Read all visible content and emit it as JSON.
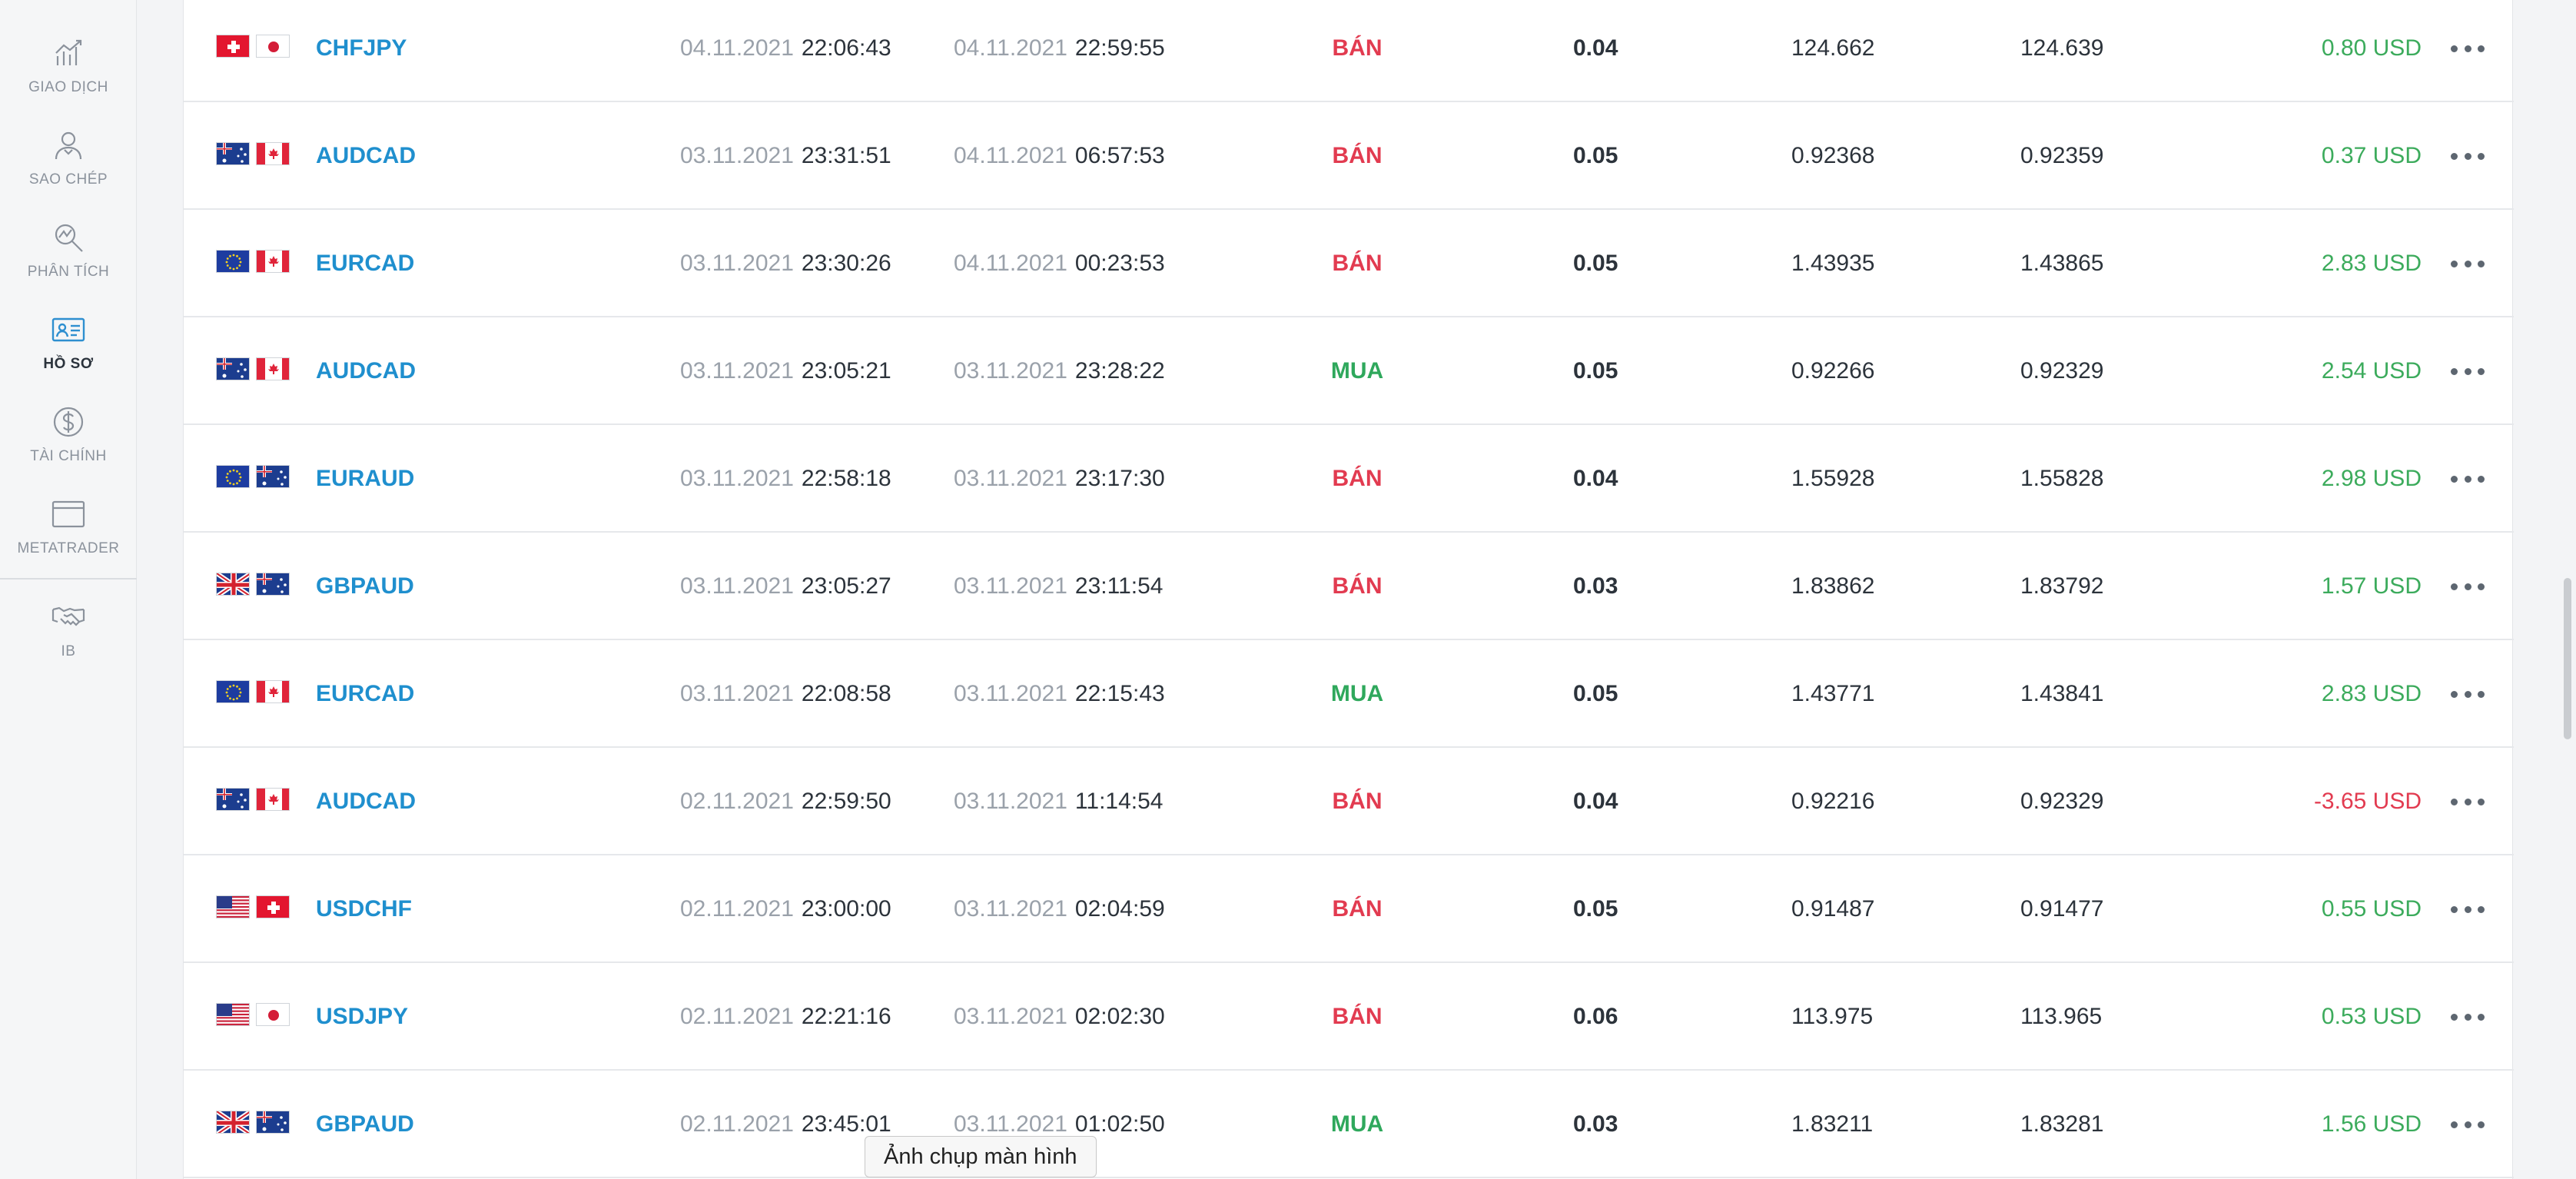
{
  "sidebar": {
    "items": [
      {
        "label": "GIAO DỊCH",
        "icon": "trading-chart-icon"
      },
      {
        "label": "SAO CHÉP",
        "icon": "copy-trader-icon"
      },
      {
        "label": "PHÂN TÍCH",
        "icon": "analytics-icon"
      },
      {
        "label": "HỒ SƠ",
        "icon": "profile-card-icon",
        "active": true
      },
      {
        "label": "TÀI CHÍNH",
        "icon": "dollar-icon"
      },
      {
        "label": "METATRADER",
        "icon": "window-icon"
      },
      {
        "label": "IB",
        "icon": "handshake-icon"
      }
    ]
  },
  "trades": [
    {
      "symbol": "CHFJPY",
      "flags": [
        "ch",
        "jp"
      ],
      "open_date": "04.11.2021",
      "open_time": "22:06:43",
      "close_date": "04.11.2021",
      "close_time": "22:59:55",
      "side": "BÁN",
      "side_type": "sell",
      "volume": "0.04",
      "open_price": "124.662",
      "close_price": "124.639",
      "profit": "0.80 USD",
      "profit_sign": "pos"
    },
    {
      "symbol": "AUDCAD",
      "flags": [
        "au",
        "ca"
      ],
      "open_date": "03.11.2021",
      "open_time": "23:31:51",
      "close_date": "04.11.2021",
      "close_time": "06:57:53",
      "side": "BÁN",
      "side_type": "sell",
      "volume": "0.05",
      "open_price": "0.92368",
      "close_price": "0.92359",
      "profit": "0.37 USD",
      "profit_sign": "pos"
    },
    {
      "symbol": "EURCAD",
      "flags": [
        "eu",
        "ca"
      ],
      "open_date": "03.11.2021",
      "open_time": "23:30:26",
      "close_date": "04.11.2021",
      "close_time": "00:23:53",
      "side": "BÁN",
      "side_type": "sell",
      "volume": "0.05",
      "open_price": "1.43935",
      "close_price": "1.43865",
      "profit": "2.83 USD",
      "profit_sign": "pos"
    },
    {
      "symbol": "AUDCAD",
      "flags": [
        "au",
        "ca"
      ],
      "open_date": "03.11.2021",
      "open_time": "23:05:21",
      "close_date": "03.11.2021",
      "close_time": "23:28:22",
      "side": "MUA",
      "side_type": "buy",
      "volume": "0.05",
      "open_price": "0.92266",
      "close_price": "0.92329",
      "profit": "2.54 USD",
      "profit_sign": "pos"
    },
    {
      "symbol": "EURAUD",
      "flags": [
        "eu",
        "au"
      ],
      "open_date": "03.11.2021",
      "open_time": "22:58:18",
      "close_date": "03.11.2021",
      "close_time": "23:17:30",
      "side": "BÁN",
      "side_type": "sell",
      "volume": "0.04",
      "open_price": "1.55928",
      "close_price": "1.55828",
      "profit": "2.98 USD",
      "profit_sign": "pos"
    },
    {
      "symbol": "GBPAUD",
      "flags": [
        "gb",
        "au"
      ],
      "open_date": "03.11.2021",
      "open_time": "23:05:27",
      "close_date": "03.11.2021",
      "close_time": "23:11:54",
      "side": "BÁN",
      "side_type": "sell",
      "volume": "0.03",
      "open_price": "1.83862",
      "close_price": "1.83792",
      "profit": "1.57 USD",
      "profit_sign": "pos"
    },
    {
      "symbol": "EURCAD",
      "flags": [
        "eu",
        "ca"
      ],
      "open_date": "03.11.2021",
      "open_time": "22:08:58",
      "close_date": "03.11.2021",
      "close_time": "22:15:43",
      "side": "MUA",
      "side_type": "buy",
      "volume": "0.05",
      "open_price": "1.43771",
      "close_price": "1.43841",
      "profit": "2.83 USD",
      "profit_sign": "pos"
    },
    {
      "symbol": "AUDCAD",
      "flags": [
        "au",
        "ca"
      ],
      "open_date": "02.11.2021",
      "open_time": "22:59:50",
      "close_date": "03.11.2021",
      "close_time": "11:14:54",
      "side": "BÁN",
      "side_type": "sell",
      "volume": "0.04",
      "open_price": "0.92216",
      "close_price": "0.92329",
      "profit": "-3.65 USD",
      "profit_sign": "neg"
    },
    {
      "symbol": "USDCHF",
      "flags": [
        "us",
        "ch"
      ],
      "open_date": "02.11.2021",
      "open_time": "23:00:00",
      "close_date": "03.11.2021",
      "close_time": "02:04:59",
      "side": "BÁN",
      "side_type": "sell",
      "volume": "0.05",
      "open_price": "0.91487",
      "close_price": "0.91477",
      "profit": "0.55 USD",
      "profit_sign": "pos"
    },
    {
      "symbol": "USDJPY",
      "flags": [
        "us",
        "jp"
      ],
      "open_date": "02.11.2021",
      "open_time": "22:21:16",
      "close_date": "03.11.2021",
      "close_time": "02:02:30",
      "side": "BÁN",
      "side_type": "sell",
      "volume": "0.06",
      "open_price": "113.975",
      "close_price": "113.965",
      "profit": "0.53 USD",
      "profit_sign": "pos"
    },
    {
      "symbol": "GBPAUD",
      "flags": [
        "gb",
        "au"
      ],
      "open_date": "02.11.2021",
      "open_time": "23:45:01",
      "close_date": "03.11.2021",
      "close_time": "01:02:50",
      "side": "MUA",
      "side_type": "buy",
      "volume": "0.03",
      "open_price": "1.83211",
      "close_price": "1.83281",
      "profit": "1.56 USD",
      "profit_sign": "pos"
    }
  ],
  "colors": {
    "symbol": "#1f8fce",
    "sell": "#e23b50",
    "buy": "#2fa85c",
    "profit_positive": "#3cab5c",
    "profit_negative": "#e23b50"
  },
  "tooltip": {
    "label": "Ảnh chụp màn hình"
  }
}
